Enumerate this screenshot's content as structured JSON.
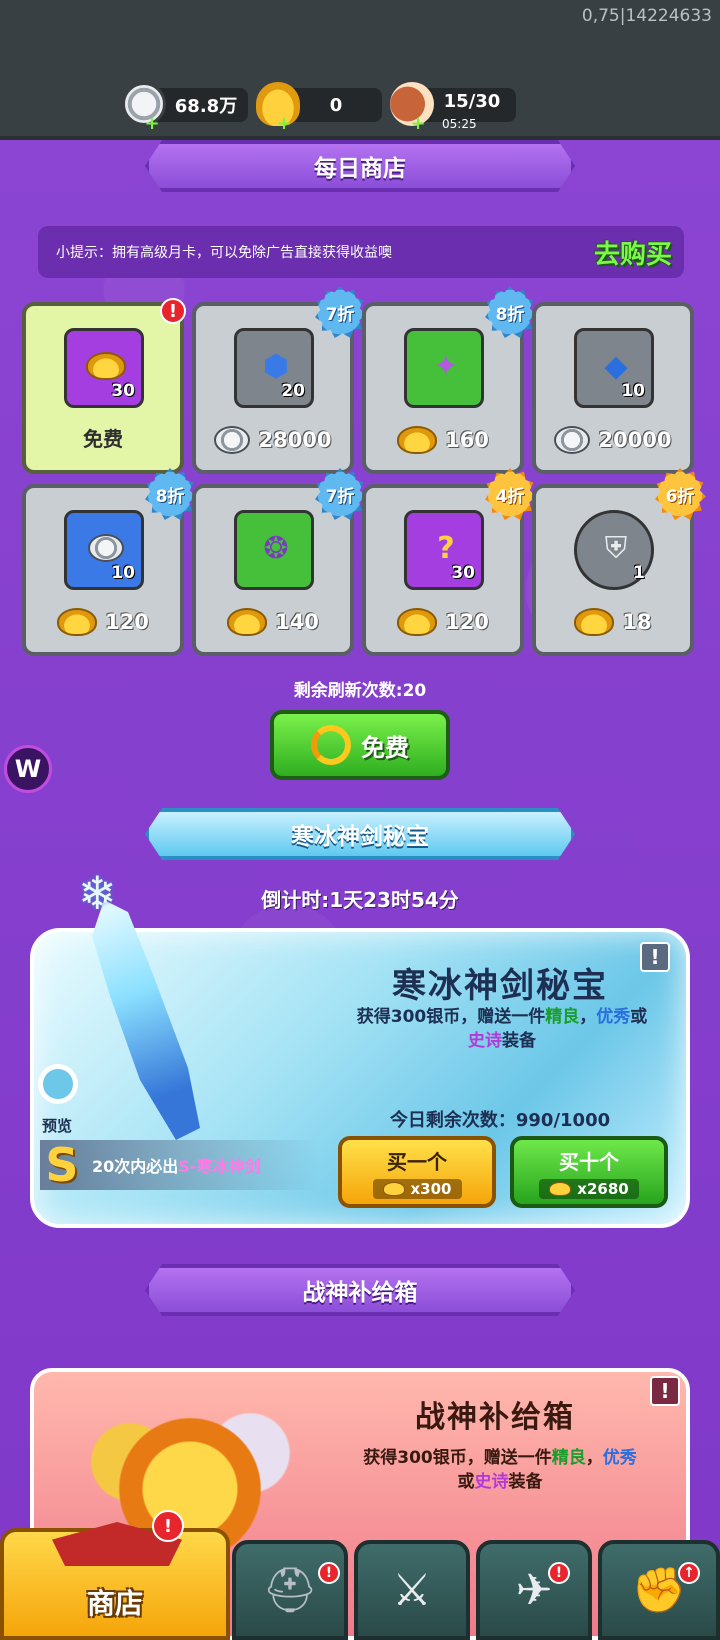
{
  "debug": "0,75|14224633",
  "resources": {
    "silver": "68.8万",
    "gold": "0",
    "stamina": "15/30",
    "stamina_timer": "05:25"
  },
  "daily_shop": {
    "title": "每日商店",
    "tip": "小提示：拥有高级月卡，可以免除广告直接获得收益噢",
    "tip_button": "去购买",
    "items": [
      {
        "qty": "30",
        "price": "免费",
        "discount": ""
      },
      {
        "qty": "20",
        "price": "28000",
        "discount": "7折"
      },
      {
        "qty": "",
        "price": "160",
        "discount": "8折"
      },
      {
        "qty": "10",
        "price": "20000",
        "discount": ""
      },
      {
        "qty": "10",
        "price": "120",
        "discount": "8折"
      },
      {
        "qty": "",
        "price": "140",
        "discount": "7折"
      },
      {
        "qty": "30",
        "price": "120",
        "discount": "4折"
      },
      {
        "qty": "1",
        "price": "18",
        "discount": "6折"
      }
    ],
    "refresh_count": "剩余刷新次数:20",
    "refresh_button": "免费"
  },
  "side_badge": "W",
  "ice_sword": {
    "banner": "寒冰神剑秘宝",
    "countdown": "倒计时:1天23时54分",
    "title": "寒冰神剑秘宝",
    "desc_prefix": "获得300银币，赠送一件",
    "desc_good": "精良",
    "desc_comma": "，",
    "desc_great": "优秀",
    "desc_or": "或",
    "desc_epic": "史诗",
    "desc_suffix": "装备",
    "remain": "今日剩余次数：990/1000",
    "preview": "预览",
    "guarantee_rank": "S",
    "guarantee_prefix": "20次内必出",
    "guarantee_item": "S-寒冰神剑",
    "buy_one": "买一个",
    "buy_one_price": "x300",
    "buy_ten": "买十个",
    "buy_ten_price": "x2680"
  },
  "supply": {
    "banner": "战神补给箱",
    "title": "战神补给箱",
    "desc_prefix": "获得300银币，赠送一件",
    "desc_good": "精良",
    "desc_comma": "，",
    "desc_great": "优秀",
    "desc_or": "或",
    "desc_epic": "史诗",
    "desc_suffix": "装备"
  },
  "nav": {
    "shop": "商店"
  }
}
